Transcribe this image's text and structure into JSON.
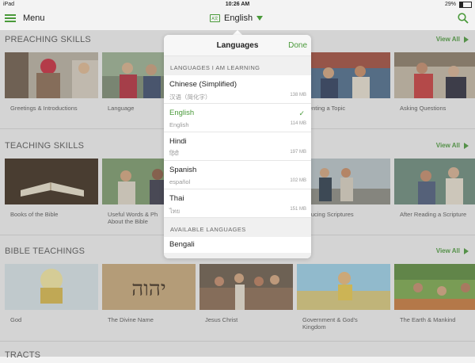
{
  "status": {
    "device": "iPad",
    "time": "10:26 AM",
    "battery": "29%",
    "battery_level": 0.29
  },
  "topbar": {
    "menu_label": "Menu",
    "language": "English"
  },
  "sections": [
    {
      "title": "PREACHING SKILLS",
      "view_all": "View All",
      "tiles": [
        "Greetings & Introductions",
        "Language",
        "",
        "esenting a Topic",
        "Asking Questions"
      ]
    },
    {
      "title": "TEACHING SKILLS",
      "view_all": "View All",
      "tiles": [
        "Books of the Bible",
        "Useful Words & Ph\nAbout the Bible",
        "",
        "roducing Scriptures",
        "After Reading a Scripture"
      ]
    },
    {
      "title": "BIBLE TEACHINGS",
      "view_all": "View All",
      "tiles": [
        "God",
        "The Divine Name",
        "Jesus Christ",
        "Government & God's\nKingdom",
        "The Earth & Mankind"
      ]
    },
    {
      "title": "TRACTS",
      "view_all": ""
    }
  ],
  "languages_popover": {
    "title": "Languages",
    "done_label": "Done",
    "learning_header": "LANGUAGES I AM LEARNING",
    "learning": [
      {
        "name": "Chinese (Simplified)",
        "native": "汉语（简化字）",
        "size": "138 MB",
        "selected": false
      },
      {
        "name": "English",
        "native": "English",
        "size": "114 MB",
        "selected": true
      },
      {
        "name": "Hindi",
        "native": "हिंदी",
        "size": "197 MB",
        "selected": false
      },
      {
        "name": "Spanish",
        "native": "español",
        "size": "102 MB",
        "selected": false
      },
      {
        "name": "Thai",
        "native": "ไทย",
        "size": "151 MB",
        "selected": false
      }
    ],
    "available_header": "AVAILABLE LANGUAGES",
    "available": [
      {
        "name": "Bengali"
      }
    ]
  },
  "colors": {
    "accent": "#4a9a3a",
    "background": "#f3f3f3"
  },
  "icons": [
    "hamburger-icon",
    "language-icon",
    "caret-down-icon",
    "search-icon",
    "play-icon",
    "checkmark-icon",
    "battery-icon"
  ]
}
